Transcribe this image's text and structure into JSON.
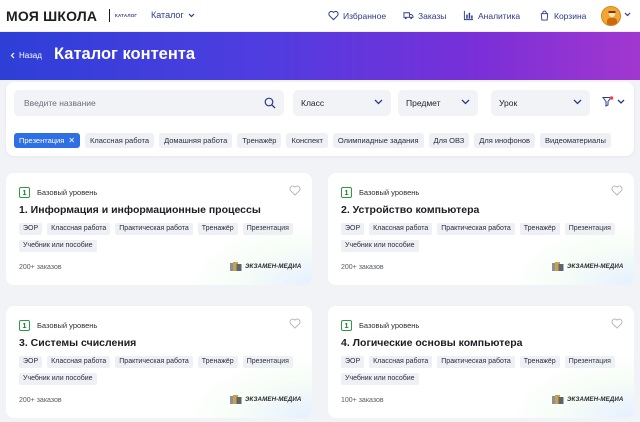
{
  "topnav": {
    "brand": "МОЯ ШКОЛА",
    "brand_sub": "КАТАЛОГ",
    "catalog": "Каталог",
    "favorites": "Избранное",
    "orders": "Заказы",
    "analytics": "Аналитика",
    "cart": "Корзина"
  },
  "hero": {
    "back": "Назад",
    "title": "Каталог контента"
  },
  "filters": {
    "search_placeholder": "Введите название",
    "class": "Класс",
    "subject": "Предмет",
    "lesson": "Урок",
    "chips": [
      {
        "label": "Презентация",
        "active": true
      },
      {
        "label": "Классная работа"
      },
      {
        "label": "Домашняя работа"
      },
      {
        "label": "Тренажёр"
      },
      {
        "label": "Конспект"
      },
      {
        "label": "Олимпиадные задания"
      },
      {
        "label": "Для ОВЗ"
      },
      {
        "label": "Для инофонов"
      },
      {
        "label": "Видеоматериалы"
      }
    ]
  },
  "cards": [
    {
      "level_num": "1",
      "level": "Базовый уровень",
      "title": "1. Информация и информационные процессы",
      "tags": [
        "ЭОР",
        "Классная работа",
        "Практическая работа",
        "Тренажёр",
        "Презентация",
        "Учебник или пособие"
      ],
      "orders": "200+ заказов",
      "publisher": "ЭКЗАМЕН-МЕДИА"
    },
    {
      "level_num": "1",
      "level": "Базовый уровень",
      "title": "2. Устройство компьютера",
      "tags": [
        "ЭОР",
        "Классная работа",
        "Практическая работа",
        "Тренажёр",
        "Презентация",
        "Учебник или пособие"
      ],
      "orders": "200+ заказов",
      "publisher": "ЭКЗАМЕН-МЕДИА"
    },
    {
      "level_num": "1",
      "level": "Базовый уровень",
      "title": "3. Системы счисления",
      "tags": [
        "ЭОР",
        "Классная работа",
        "Практическая работа",
        "Тренажёр",
        "Презентация",
        "Учебник или пособие"
      ],
      "orders": "200+ заказов",
      "publisher": "ЭКЗАМЕН-МЕДИА"
    },
    {
      "level_num": "1",
      "level": "Базовый уровень",
      "title": "4. Логические основы компьютера",
      "tags": [
        "ЭОР",
        "Классная работа",
        "Практическая работа",
        "Тренажёр",
        "Презентация",
        "Учебник или пособие"
      ],
      "orders": "100+ заказов",
      "publisher": "ЭКЗАМЕН-МЕДИА"
    }
  ],
  "colors": {
    "accent_blue": "#2f6fe4",
    "nav_text": "#2b3a8c",
    "level_green": "#2e9a43",
    "hero_start": "#2d3fd6",
    "hero_end": "#a237cf"
  },
  "icons": {
    "favorites": "heart-icon",
    "orders": "truck-icon",
    "analytics": "bar-chart-icon",
    "cart": "bag-icon",
    "search": "search-icon",
    "filter": "filter-icon"
  }
}
